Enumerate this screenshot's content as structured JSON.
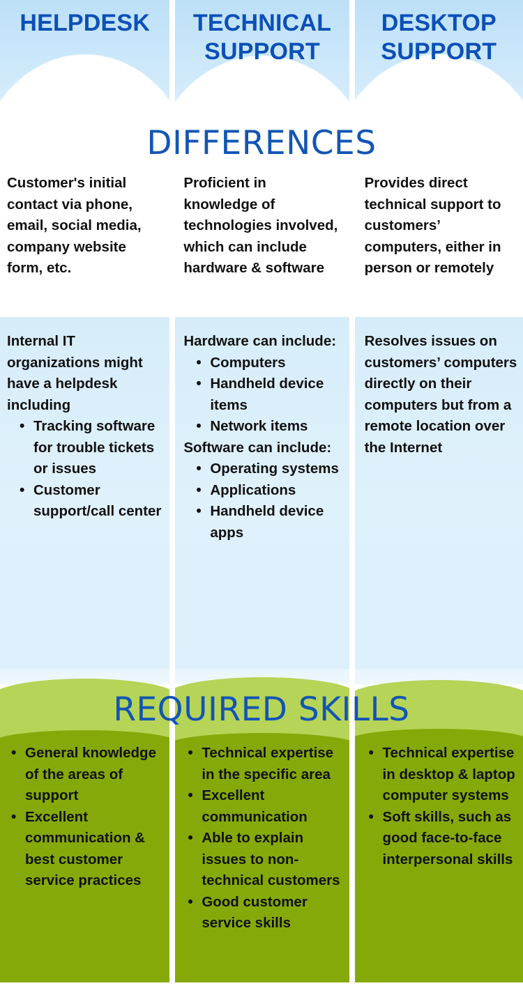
{
  "columns": [
    {
      "title": "HELPDESK"
    },
    {
      "title": "TECHNICAL SUPPORT"
    },
    {
      "title": "DESKTOP SUPPORT"
    }
  ],
  "sections": {
    "differences": {
      "heading": "DIFFERENCES",
      "row1": [
        "Customer's initial contact via phone, email, social media, company website form, etc.",
        "Proficient in knowledge of technologies involved, which can include hardware & software",
        "Provides direct technical support to customers’ computers, either in person or remotely"
      ],
      "row2": {
        "helpdesk": {
          "intro": "Internal IT organizations might have a helpdesk including",
          "bullets": [
            "Tracking software for trouble tickets or issues",
            "Customer support/call center"
          ]
        },
        "technical": {
          "intro_hardware": "Hardware can include:",
          "bullets_hardware": [
            "Computers",
            "Handheld device items",
            "Network items"
          ],
          "intro_software": "Software can include:",
          "bullets_software": [
            "Operating systems",
            "Applications",
            "Handheld device apps"
          ]
        },
        "desktop": {
          "text": "Resolves issues on customers’ computers directly on their computers but from a remote location over the Internet"
        }
      }
    },
    "required_skills": {
      "heading": "REQUIRED SKILLS",
      "helpdesk": [
        "General knowledge of the areas of support",
        "Excellent communication & best customer service practices"
      ],
      "technical": [
        "Technical expertise in the specific area",
        "Excellent communication",
        "Able to explain issues to non-technical customers",
        "Good customer service skills"
      ],
      "desktop": [
        "Technical expertise in desktop & laptop computer systems",
        "Soft skills, such as good face-to-face interpersonal skills"
      ]
    }
  },
  "colors": {
    "title_blue": "#0c50b7",
    "heading_blue": "#1255b5",
    "sky_blue": "#c9e6fa",
    "panel_blue": "#dcf0fb",
    "hill_light_green": "#b6d457",
    "hill_dark_green": "#86a90a",
    "body_text": "#111111"
  }
}
